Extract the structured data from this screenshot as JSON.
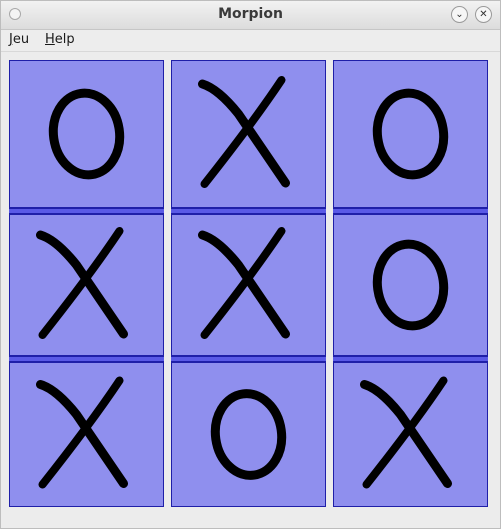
{
  "window": {
    "title": "Morpion"
  },
  "menu": {
    "jeu_mnemonic": "J",
    "jeu_rest": "eu",
    "help_mnemonic": "H",
    "help_rest": "elp"
  },
  "colors": {
    "cell_fill": "#8f8fee",
    "cell_border": "#1f1fa8",
    "separator": "#5a5ae6",
    "mark": "#000000"
  },
  "board": {
    "cells": [
      [
        "O",
        "X",
        "O"
      ],
      [
        "X",
        "X",
        "O"
      ],
      [
        "X",
        "O",
        "X"
      ]
    ]
  }
}
